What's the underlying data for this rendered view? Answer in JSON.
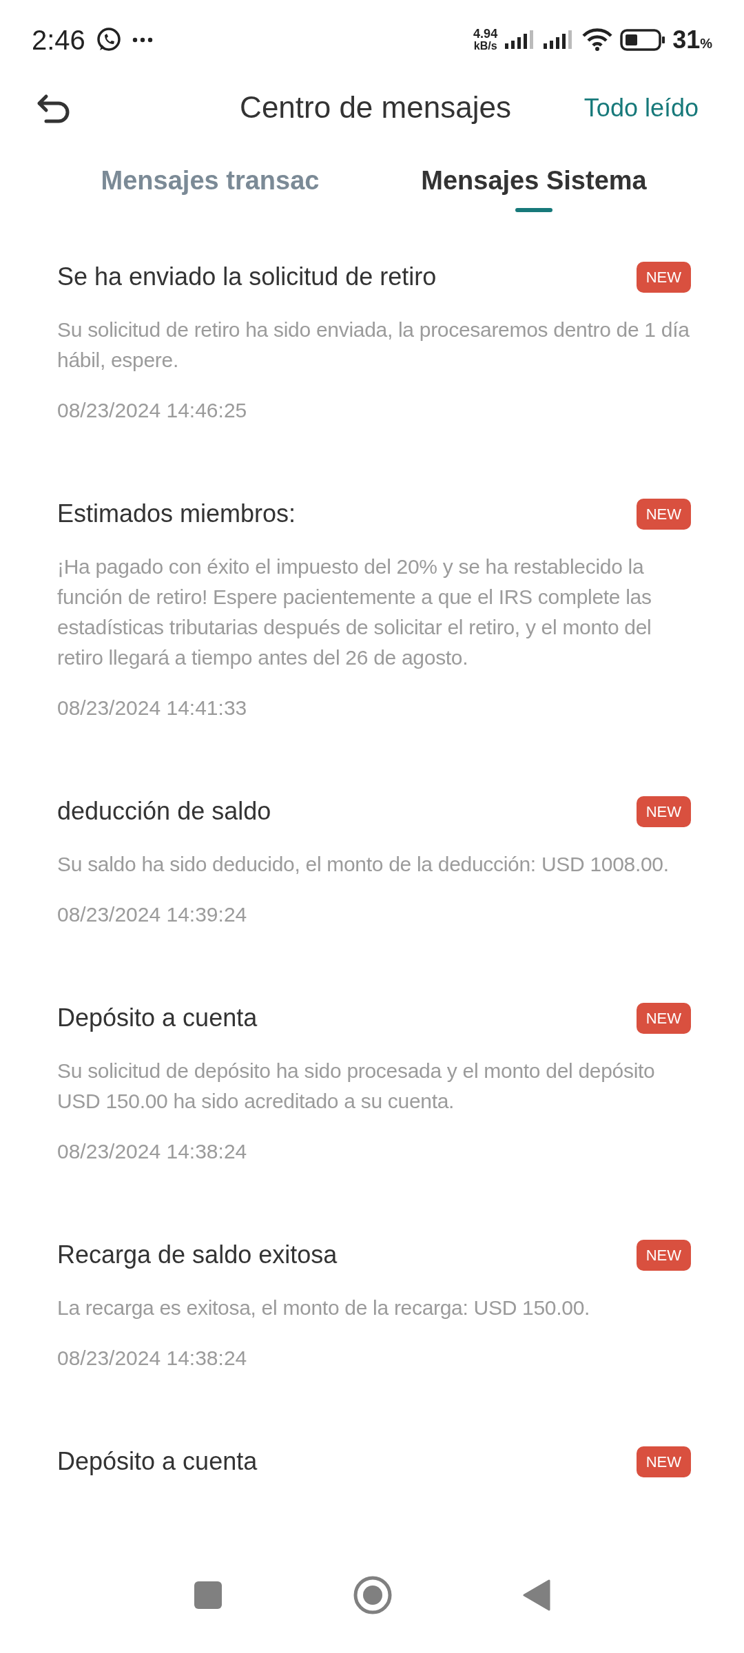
{
  "status_bar": {
    "time": "2:46",
    "net_speed": "4.94",
    "net_unit": "kB/s",
    "battery": "31",
    "battery_unit": "%"
  },
  "header": {
    "title": "Centro de mensajes",
    "action": "Todo leído"
  },
  "tabs": [
    {
      "label": "Mensajes transac",
      "selected": false
    },
    {
      "label": "Mensajes Sistema",
      "selected": true
    }
  ],
  "messages": [
    {
      "title": "Se ha enviado la solicitud de retiro",
      "badge": "NEW",
      "body": "Su solicitud de retiro ha sido enviada, la procesaremos dentro de 1 día hábil, espere.",
      "date": "08/23/2024 14:46:25"
    },
    {
      "title": "Estimados miembros:",
      "badge": "NEW",
      "body": "¡Ha pagado con éxito el impuesto del 20% y se ha restablecido la función de retiro! Espere pacientemente a que el IRS complete las estadísticas tributarias después de solicitar el retiro, y el monto del retiro llegará a tiempo antes del 26 de agosto.",
      "date": "08/23/2024 14:41:33"
    },
    {
      "title": "deducción de saldo",
      "badge": "NEW",
      "body": "Su saldo ha sido deducido, el monto de la deducción: USD 1008.00.",
      "date": "08/23/2024 14:39:24"
    },
    {
      "title": "Depósito a cuenta",
      "badge": "NEW",
      "body": "Su solicitud de depósito ha sido procesada y el monto del depósito USD 150.00 ha sido acreditado a su cuenta.",
      "date": "08/23/2024 14:38:24"
    },
    {
      "title": "Recarga de saldo exitosa",
      "badge": "NEW",
      "body": "La recarga es exitosa, el monto de la recarga: USD 150.00.",
      "date": "08/23/2024 14:38:24"
    },
    {
      "title": "Depósito a cuenta",
      "badge": "NEW"
    }
  ]
}
